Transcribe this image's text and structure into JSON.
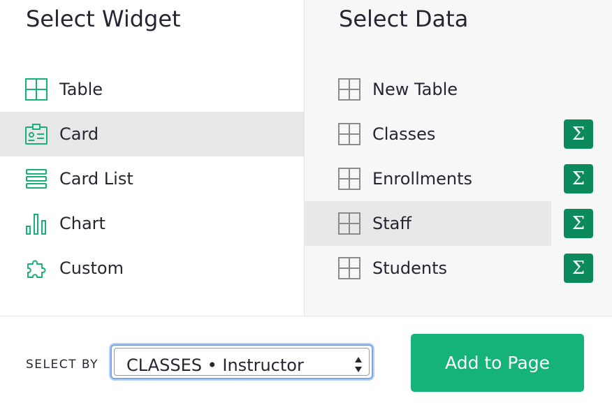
{
  "widgets": {
    "title": "Select Widget",
    "items": [
      {
        "label": "Table",
        "icon": "table-icon"
      },
      {
        "label": "Card",
        "icon": "card-icon",
        "selected": true
      },
      {
        "label": "Card List",
        "icon": "card-list-icon"
      },
      {
        "label": "Chart",
        "icon": "chart-icon"
      },
      {
        "label": "Custom",
        "icon": "puzzle-icon"
      }
    ]
  },
  "data_sources": {
    "title": "Select Data",
    "items": [
      {
        "label": "New Table",
        "icon": "table-icon",
        "summary": false
      },
      {
        "label": "Classes",
        "icon": "table-icon",
        "summary": true
      },
      {
        "label": "Enrollments",
        "icon": "table-icon",
        "summary": true
      },
      {
        "label": "Staff",
        "icon": "table-icon",
        "summary": true,
        "selected": true
      },
      {
        "label": "Students",
        "icon": "table-icon",
        "summary": true
      }
    ],
    "summary_symbol": "Σ"
  },
  "footer": {
    "select_by_label": "SELECT BY",
    "select_by_value": "CLASSES • Instructor",
    "add_button_label": "Add to Page"
  },
  "colors": {
    "accent": "#16b378",
    "summary_button": "#0d8a5b",
    "selected_row": "#e8e8e8"
  }
}
